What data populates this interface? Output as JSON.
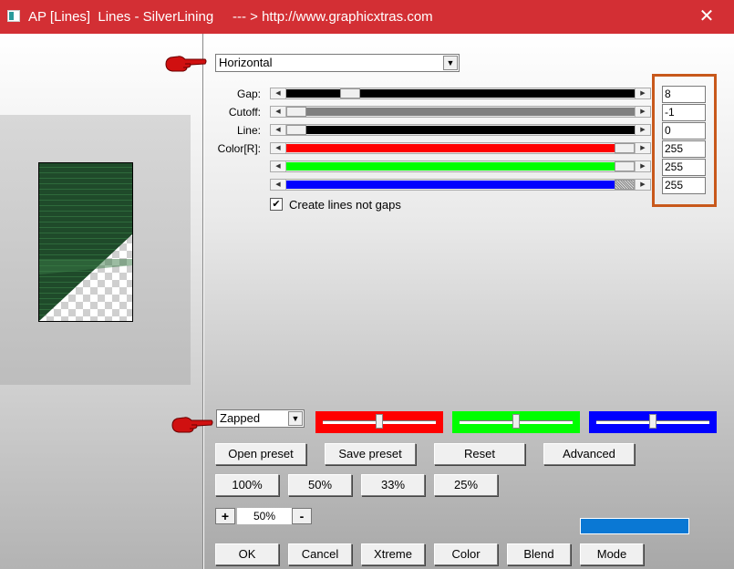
{
  "window": {
    "title": "AP [Lines]  Lines - SilverLining     --- > http://www.graphicxtras.com"
  },
  "controls": {
    "direction_select": "Horizontal",
    "mode_select": "Zapped",
    "sliders": [
      {
        "label": "Gap:",
        "value": "8",
        "level": 0.17,
        "color": "#000000"
      },
      {
        "label": "Cutoff:",
        "value": "-1",
        "level": 0.0,
        "color": "#808080"
      },
      {
        "label": "Line:",
        "value": "0",
        "level": 0.0,
        "color": "#000000"
      },
      {
        "label": "Color[R]:",
        "value": "255",
        "level": 1.0,
        "color": "#ff0000"
      },
      {
        "label": "",
        "value": "255",
        "level": 1.0,
        "color": "#00ff00"
      },
      {
        "label": "",
        "value": "255",
        "level": 1.0,
        "color": "#0000ff"
      }
    ],
    "checkbox_label": "Create lines not gaps",
    "checkbox_checked": true
  },
  "mini_sliders": [
    {
      "color": "#ff0000",
      "level": 0.5
    },
    {
      "color": "#00ff00",
      "level": 0.5
    },
    {
      "color": "#0000ff",
      "level": 0.5
    }
  ],
  "buttons": {
    "open_preset": "Open preset",
    "save_preset": "Save preset",
    "reset": "Reset",
    "advanced": "Advanced",
    "zoom_100": "100%",
    "zoom_50": "50%",
    "zoom_33": "33%",
    "zoom_25": "25%",
    "zoom_plus": "+",
    "zoom_minus": "-",
    "zoom_value": "50%",
    "ok": "OK",
    "cancel": "Cancel",
    "xtreme": "Xtreme",
    "color": "Color",
    "blend": "Blend",
    "mode": "Mode"
  },
  "colors": {
    "titlebar": "#d32f34",
    "highlight_box": "#c8581b",
    "swatch": "#0a78d4",
    "preview_green": "#1f4a2a"
  }
}
